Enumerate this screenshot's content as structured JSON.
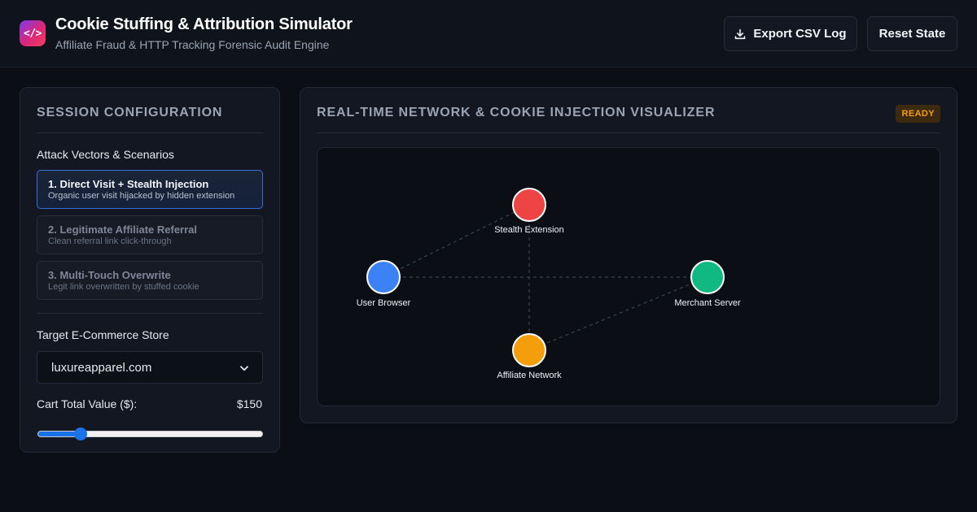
{
  "header": {
    "logo_glyph": "</>",
    "title": "Cookie Stuffing & Attribution Simulator",
    "subtitle": "Affiliate Fraud & HTTP Tracking Forensic Audit Engine",
    "export_label": "Export CSV Log",
    "reset_label": "Reset State"
  },
  "config": {
    "heading": "SESSION CONFIGURATION",
    "vectors_label": "Attack Vectors & Scenarios",
    "scenarios": [
      {
        "title": "1. Direct Visit + Stealth Injection",
        "desc": "Organic user visit hijacked by hidden extension",
        "active": true
      },
      {
        "title": "2. Legitimate Affiliate Referral",
        "desc": "Clean referral link click-through",
        "active": false
      },
      {
        "title": "3. Multi-Touch Overwrite",
        "desc": "Legit link overwritten by stuffed cookie",
        "active": false
      }
    ],
    "store_label": "Target E-Commerce Store",
    "store_value": "luxureapparel.com",
    "cart_label": "Cart Total Value ($):",
    "cart_value": "$150",
    "cart_slider_fraction": 0.19
  },
  "visualizer": {
    "heading": "REAL-TIME NETWORK & COOKIE INJECTION VISUALIZER",
    "status": "READY",
    "status_color": "#f59e0b",
    "nodes": [
      {
        "id": "browser",
        "label": "User Browser",
        "color": "#3b82f6"
      },
      {
        "id": "extension",
        "label": "Stealth Extension",
        "color": "#ef4444"
      },
      {
        "id": "merchant",
        "label": "Merchant Server",
        "color": "#10b981"
      },
      {
        "id": "network",
        "label": "Affiliate Network",
        "color": "#f59e0b"
      }
    ]
  }
}
